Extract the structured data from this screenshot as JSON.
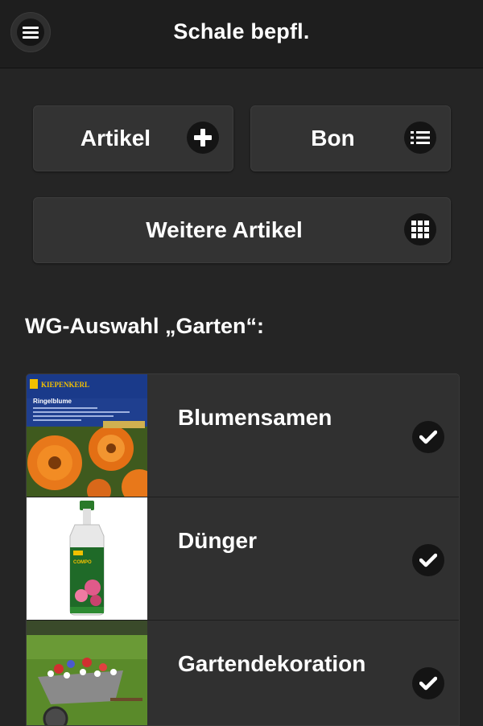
{
  "header": {
    "title": "Schale bepfl.",
    "menu_icon": "hamburger-icon"
  },
  "buttons": {
    "artikel": {
      "label": "Artikel",
      "icon": "plus-icon"
    },
    "bon": {
      "label": "Bon",
      "icon": "list-icon"
    },
    "weitere": {
      "label": "Weitere Artikel",
      "icon": "grid-icon"
    }
  },
  "section": {
    "title": "WG-Auswahl „Garten“:"
  },
  "items": [
    {
      "label": "Blumensamen",
      "icon": "check-icon",
      "thumb_brand": "KIEPENKERL",
      "thumb_product": "Ringelblume"
    },
    {
      "label": "Dünger",
      "icon": "check-icon",
      "thumb_brand": "COMPO"
    },
    {
      "label": "Gartendekoration",
      "icon": "check-icon"
    }
  ],
  "colors": {
    "background": "#252525",
    "header": "#1e1e1e",
    "button": "#333333",
    "icon_bg": "#141414"
  }
}
